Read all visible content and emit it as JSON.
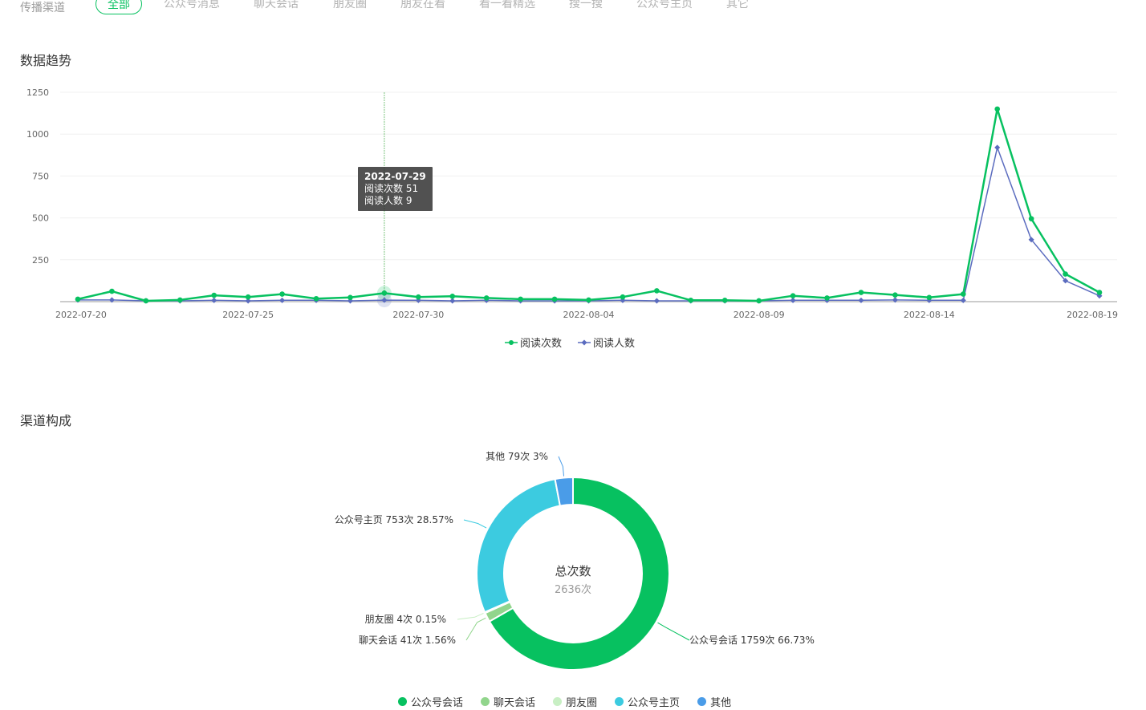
{
  "filters": {
    "label": "传播渠道",
    "tabs": [
      "全部",
      "公众号消息",
      "聊天会话",
      "朋友圈",
      "朋友在看",
      "看一看精选",
      "搜一搜",
      "公众号主页",
      "其它"
    ],
    "active_index": 0
  },
  "trend": {
    "title": "数据趋势",
    "tooltip": {
      "date": "2022-07-29",
      "line1": "阅读次数 51",
      "line2": "阅读人数 9"
    },
    "legend": [
      "阅读次数",
      "阅读人数"
    ]
  },
  "composition": {
    "title": "渠道构成",
    "center_title": "总次数",
    "center_value": "2636次",
    "legend": [
      "公众号会话",
      "聊天会话",
      "朋友圈",
      "公众号主页",
      "其他"
    ]
  },
  "colors": {
    "green": "#07c160",
    "purple": "#5b6cbf",
    "light_green": "#91d58c",
    "pale_green": "#c8efc4",
    "cyan": "#3ccbe0",
    "blue": "#4a9ce8",
    "axis": "#bbbbbb",
    "grid": "#f0f0f0"
  },
  "chart_data": [
    {
      "type": "line",
      "title": "数据趋势",
      "x": [
        "2022-07-20",
        "2022-07-21",
        "2022-07-22",
        "2022-07-23",
        "2022-07-24",
        "2022-07-25",
        "2022-07-26",
        "2022-07-27",
        "2022-07-28",
        "2022-07-29",
        "2022-07-30",
        "2022-07-31",
        "2022-08-01",
        "2022-08-02",
        "2022-08-03",
        "2022-08-04",
        "2022-08-05",
        "2022-08-06",
        "2022-08-07",
        "2022-08-08",
        "2022-08-09",
        "2022-08-10",
        "2022-08-11",
        "2022-08-12",
        "2022-08-13",
        "2022-08-14",
        "2022-08-15",
        "2022-08-16",
        "2022-08-17",
        "2022-08-18",
        "2022-08-19"
      ],
      "x_tick_labels": [
        "2022-07-20",
        "2022-07-25",
        "2022-07-30",
        "2022-08-04",
        "2022-08-09",
        "2022-08-14",
        "2022-08-19"
      ],
      "y_ticks": [
        250,
        500,
        750,
        1000,
        1250
      ],
      "ylim": [
        0,
        1250
      ],
      "grid": true,
      "legend_position": "bottom",
      "series": [
        {
          "name": "阅读次数",
          "values": [
            15,
            62,
            5,
            10,
            38,
            28,
            45,
            18,
            25,
            51,
            28,
            32,
            22,
            15,
            15,
            10,
            28,
            65,
            8,
            8,
            5,
            35,
            22,
            55,
            40,
            25,
            45,
            1150,
            495,
            165,
            55
          ]
        },
        {
          "name": "阅读人数",
          "values": [
            10,
            10,
            5,
            5,
            8,
            5,
            8,
            8,
            5,
            9,
            8,
            5,
            8,
            5,
            5,
            5,
            8,
            5,
            5,
            5,
            5,
            8,
            8,
            8,
            10,
            8,
            8,
            920,
            370,
            125,
            35
          ]
        }
      ]
    },
    {
      "type": "pie",
      "title": "渠道构成",
      "total": 2636,
      "legend_position": "bottom",
      "slices": [
        {
          "name": "公众号会话",
          "value": 1759,
          "percent": 66.73,
          "label": "公众号会话 1759次 66.73%"
        },
        {
          "name": "聊天会话",
          "value": 41,
          "percent": 1.56,
          "label": "聊天会话 41次 1.56%"
        },
        {
          "name": "朋友圈",
          "value": 4,
          "percent": 0.15,
          "label": "朋友圈 4次 0.15%"
        },
        {
          "name": "公众号主页",
          "value": 753,
          "percent": 28.57,
          "label": "公众号主页 753次 28.57%"
        },
        {
          "name": "其他",
          "value": 79,
          "percent": 3,
          "label": "其他 79次 3%"
        }
      ]
    }
  ]
}
